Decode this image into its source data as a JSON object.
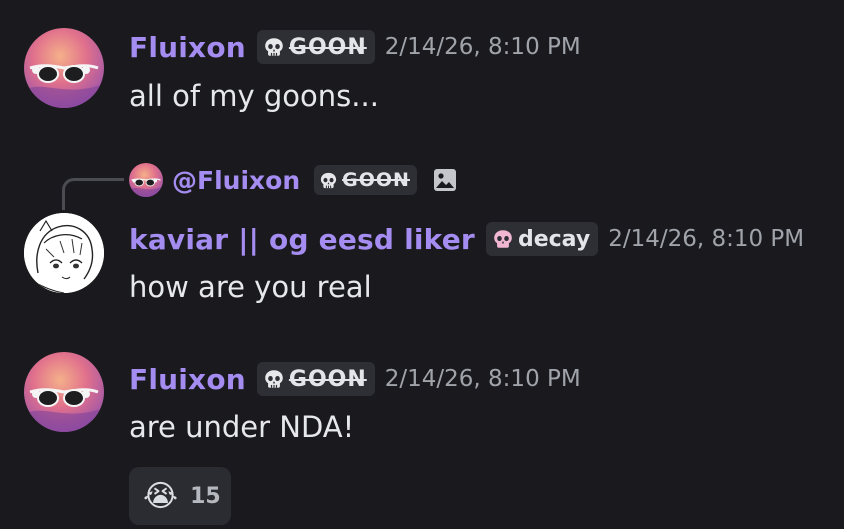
{
  "messages": [
    {
      "username": "Fluixon",
      "tag": "GOON",
      "timestamp": "2/14/26, 8:10 PM",
      "content": "all of my goons..."
    },
    {
      "reply_to": {
        "mention": "@Fluixon",
        "tag": "GOON"
      },
      "username": "kaviar || og eesd liker",
      "tag": "decay",
      "timestamp": "2/14/26, 8:10 PM",
      "content": "how are you real"
    },
    {
      "username": "Fluixon",
      "tag": "GOON",
      "timestamp": "2/14/26, 8:10 PM",
      "content": "are under NDA!",
      "reactions": [
        {
          "emoji": "😭",
          "count": "15"
        }
      ]
    }
  ],
  "icons": {
    "tag_icon": "skull-icon",
    "reply_attachment": "image-icon",
    "reaction": "loudly-crying-face"
  },
  "colors": {
    "background": "#1a1a1e",
    "username": "#a48cf0",
    "timestamp": "#a0a3aa",
    "tag_background": "#2e2f35"
  }
}
